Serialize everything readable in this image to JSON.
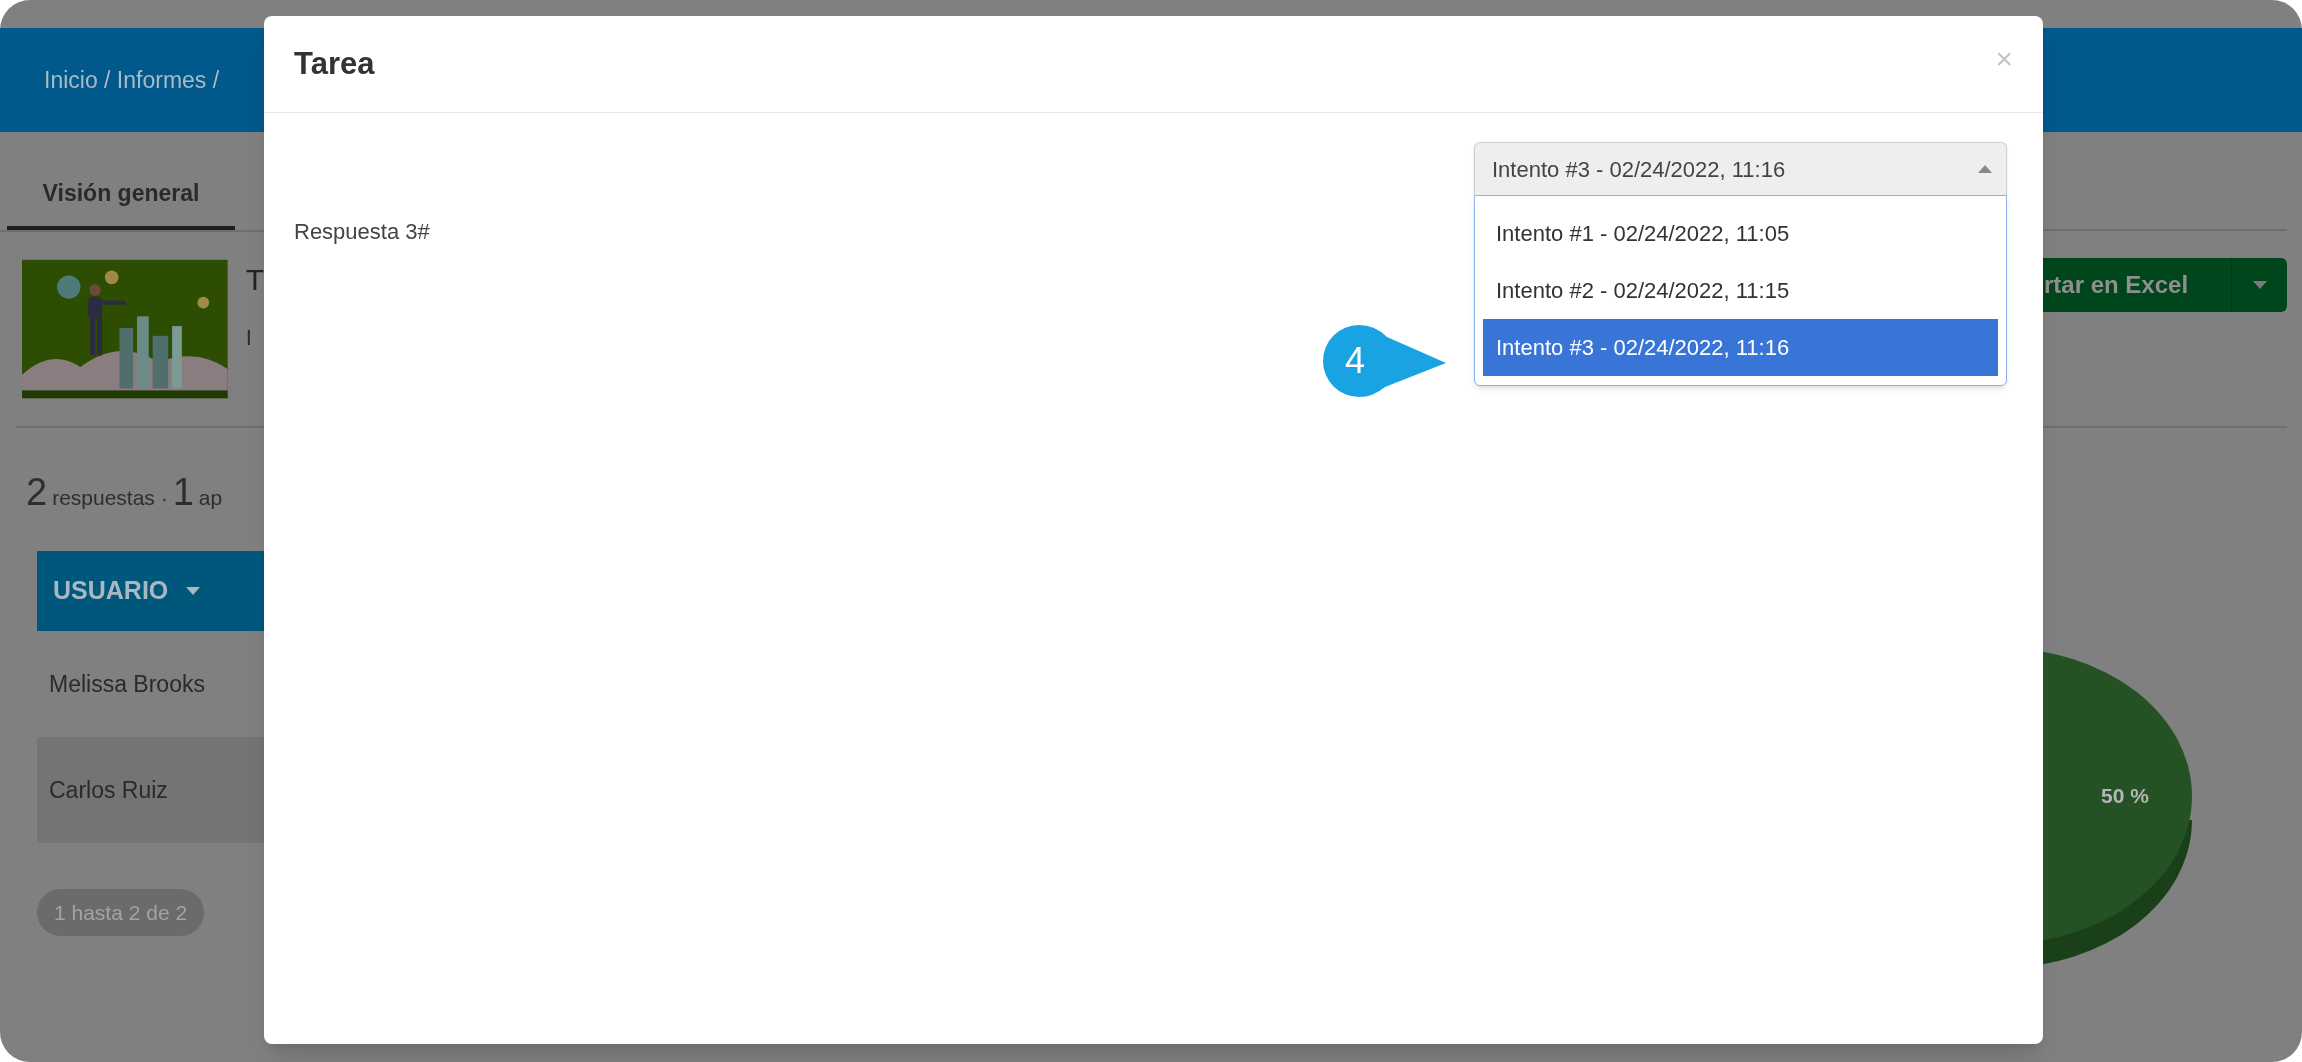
{
  "background_page": {
    "breadcrumb": "Inicio / Informes /",
    "tabs": [
      {
        "label": "Visión general",
        "selected": true
      }
    ],
    "title_fragment": "T",
    "subtitle_fragment": "I",
    "summary": {
      "responses_count": "2",
      "responses_label": "respuestas ·",
      "second_count": "1",
      "second_label": "ap"
    },
    "table": {
      "columns": [
        {
          "label": "USUARIO"
        }
      ],
      "rows": [
        {
          "cells": [
            "Melissa Brooks"
          ]
        },
        {
          "cells": [
            "Carlos Ruiz"
          ]
        }
      ]
    },
    "pagination": "1 hasta 2 de 2",
    "export_button": {
      "label": "rtar en Excel"
    },
    "pie_label": "50 %"
  },
  "modal": {
    "title": "Tarea",
    "close": "×",
    "answer": "Respuesta 3#",
    "attempt_select": {
      "value": "Intento #3 - 02/24/2022, 11:16",
      "expanded": true,
      "options": [
        {
          "label": "Intento #1 - 02/24/2022, 11:05",
          "selected": false
        },
        {
          "label": "Intento #2 - 02/24/2022, 11:15",
          "selected": false
        },
        {
          "label": "Intento #3 - 02/24/2022, 11:16",
          "selected": true
        }
      ]
    }
  },
  "callout": {
    "number": "4"
  }
}
